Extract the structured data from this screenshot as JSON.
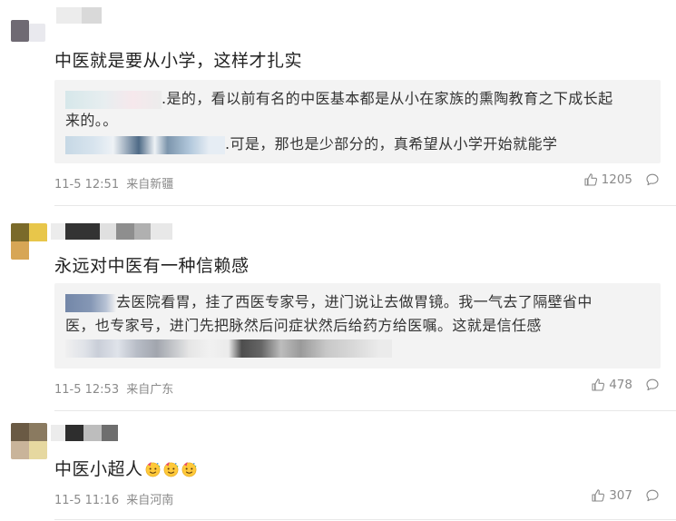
{
  "comments": [
    {
      "text": "中医就是要从小学，这样才扎实",
      "reply_lines": [
        ".是的，看以前有名的中医基本都是从小在家族的熏陶教育之下成长起",
        "来的。。",
        ".可是，那也是少部分的，真希望从小学开始就能学"
      ],
      "time": "11-5 12:51",
      "location": "来自新疆",
      "likes": "1205"
    },
    {
      "text": "永远对中医有一种信赖感",
      "reply_lines": [
        "去医院看胃，挂了西医专家号，进门说让去做胃镜。我一气去了隔壁省中",
        "医，也专家号，进门先把脉然后问症状然后给药方给医嘱。这就是信任感"
      ],
      "time": "11-5 12:53",
      "location": "来自广东",
      "likes": "478"
    },
    {
      "text": "中医小超人",
      "time": "11-5 11:16",
      "location": "来自河南",
      "likes": "307"
    }
  ],
  "icons": {
    "like": "thumbs-up-icon",
    "reply": "comment-bubble-icon",
    "emoji": "party-face-emoji"
  },
  "colors": {
    "text": "#222222",
    "meta": "#8a8a8a",
    "reply_bg": "#f3f3f3"
  }
}
